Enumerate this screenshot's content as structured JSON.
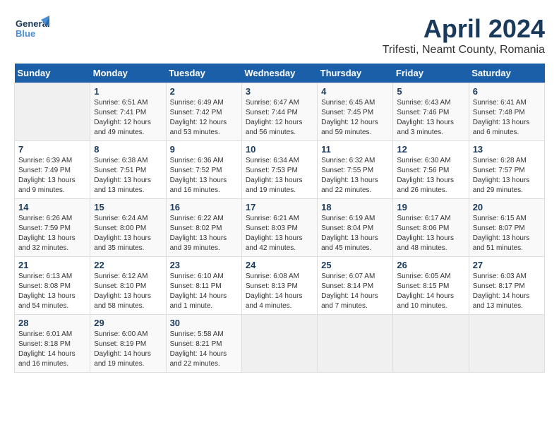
{
  "header": {
    "logo_general": "General",
    "logo_blue": "Blue",
    "title": "April 2024",
    "location": "Trifesti, Neamt County, Romania"
  },
  "weekdays": [
    "Sunday",
    "Monday",
    "Tuesday",
    "Wednesday",
    "Thursday",
    "Friday",
    "Saturday"
  ],
  "weeks": [
    [
      {
        "day": "",
        "info": ""
      },
      {
        "day": "1",
        "info": "Sunrise: 6:51 AM\nSunset: 7:41 PM\nDaylight: 12 hours\nand 49 minutes."
      },
      {
        "day": "2",
        "info": "Sunrise: 6:49 AM\nSunset: 7:42 PM\nDaylight: 12 hours\nand 53 minutes."
      },
      {
        "day": "3",
        "info": "Sunrise: 6:47 AM\nSunset: 7:44 PM\nDaylight: 12 hours\nand 56 minutes."
      },
      {
        "day": "4",
        "info": "Sunrise: 6:45 AM\nSunset: 7:45 PM\nDaylight: 12 hours\nand 59 minutes."
      },
      {
        "day": "5",
        "info": "Sunrise: 6:43 AM\nSunset: 7:46 PM\nDaylight: 13 hours\nand 3 minutes."
      },
      {
        "day": "6",
        "info": "Sunrise: 6:41 AM\nSunset: 7:48 PM\nDaylight: 13 hours\nand 6 minutes."
      }
    ],
    [
      {
        "day": "7",
        "info": "Sunrise: 6:39 AM\nSunset: 7:49 PM\nDaylight: 13 hours\nand 9 minutes."
      },
      {
        "day": "8",
        "info": "Sunrise: 6:38 AM\nSunset: 7:51 PM\nDaylight: 13 hours\nand 13 minutes."
      },
      {
        "day": "9",
        "info": "Sunrise: 6:36 AM\nSunset: 7:52 PM\nDaylight: 13 hours\nand 16 minutes."
      },
      {
        "day": "10",
        "info": "Sunrise: 6:34 AM\nSunset: 7:53 PM\nDaylight: 13 hours\nand 19 minutes."
      },
      {
        "day": "11",
        "info": "Sunrise: 6:32 AM\nSunset: 7:55 PM\nDaylight: 13 hours\nand 22 minutes."
      },
      {
        "day": "12",
        "info": "Sunrise: 6:30 AM\nSunset: 7:56 PM\nDaylight: 13 hours\nand 26 minutes."
      },
      {
        "day": "13",
        "info": "Sunrise: 6:28 AM\nSunset: 7:57 PM\nDaylight: 13 hours\nand 29 minutes."
      }
    ],
    [
      {
        "day": "14",
        "info": "Sunrise: 6:26 AM\nSunset: 7:59 PM\nDaylight: 13 hours\nand 32 minutes."
      },
      {
        "day": "15",
        "info": "Sunrise: 6:24 AM\nSunset: 8:00 PM\nDaylight: 13 hours\nand 35 minutes."
      },
      {
        "day": "16",
        "info": "Sunrise: 6:22 AM\nSunset: 8:02 PM\nDaylight: 13 hours\nand 39 minutes."
      },
      {
        "day": "17",
        "info": "Sunrise: 6:21 AM\nSunset: 8:03 PM\nDaylight: 13 hours\nand 42 minutes."
      },
      {
        "day": "18",
        "info": "Sunrise: 6:19 AM\nSunset: 8:04 PM\nDaylight: 13 hours\nand 45 minutes."
      },
      {
        "day": "19",
        "info": "Sunrise: 6:17 AM\nSunset: 8:06 PM\nDaylight: 13 hours\nand 48 minutes."
      },
      {
        "day": "20",
        "info": "Sunrise: 6:15 AM\nSunset: 8:07 PM\nDaylight: 13 hours\nand 51 minutes."
      }
    ],
    [
      {
        "day": "21",
        "info": "Sunrise: 6:13 AM\nSunset: 8:08 PM\nDaylight: 13 hours\nand 54 minutes."
      },
      {
        "day": "22",
        "info": "Sunrise: 6:12 AM\nSunset: 8:10 PM\nDaylight: 13 hours\nand 58 minutes."
      },
      {
        "day": "23",
        "info": "Sunrise: 6:10 AM\nSunset: 8:11 PM\nDaylight: 14 hours\nand 1 minute."
      },
      {
        "day": "24",
        "info": "Sunrise: 6:08 AM\nSunset: 8:13 PM\nDaylight: 14 hours\nand 4 minutes."
      },
      {
        "day": "25",
        "info": "Sunrise: 6:07 AM\nSunset: 8:14 PM\nDaylight: 14 hours\nand 7 minutes."
      },
      {
        "day": "26",
        "info": "Sunrise: 6:05 AM\nSunset: 8:15 PM\nDaylight: 14 hours\nand 10 minutes."
      },
      {
        "day": "27",
        "info": "Sunrise: 6:03 AM\nSunset: 8:17 PM\nDaylight: 14 hours\nand 13 minutes."
      }
    ],
    [
      {
        "day": "28",
        "info": "Sunrise: 6:01 AM\nSunset: 8:18 PM\nDaylight: 14 hours\nand 16 minutes."
      },
      {
        "day": "29",
        "info": "Sunrise: 6:00 AM\nSunset: 8:19 PM\nDaylight: 14 hours\nand 19 minutes."
      },
      {
        "day": "30",
        "info": "Sunrise: 5:58 AM\nSunset: 8:21 PM\nDaylight: 14 hours\nand 22 minutes."
      },
      {
        "day": "",
        "info": ""
      },
      {
        "day": "",
        "info": ""
      },
      {
        "day": "",
        "info": ""
      },
      {
        "day": "",
        "info": ""
      }
    ]
  ]
}
